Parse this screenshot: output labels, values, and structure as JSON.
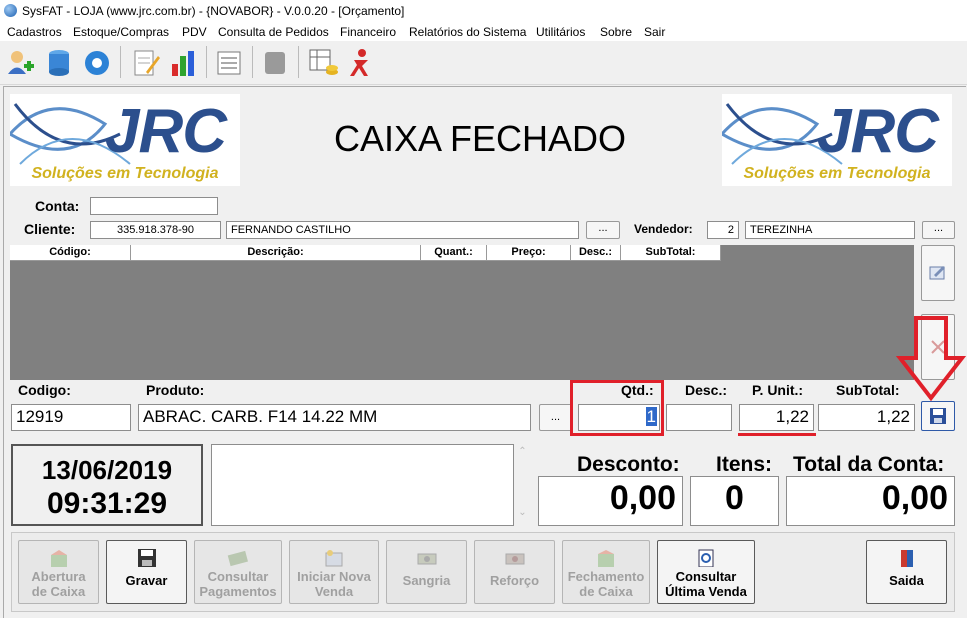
{
  "window": {
    "title": "SysFAT - LOJA (www.jrc.com.br) - {NOVABOR} - V.0.0.20 - [Orçamento]"
  },
  "menu": [
    "Cadastros",
    "Estoque/Compras",
    "PDV",
    "Consulta de Pedidos",
    "Financeiro",
    "Relatórios do Sistema",
    "Utilitários",
    "Sobre",
    "Sair"
  ],
  "logo": {
    "brand": "JRC",
    "tagline": "Soluções em Tecnologia"
  },
  "status": "CAIXA FECHADO",
  "form": {
    "conta_label": "Conta:",
    "conta_value": "",
    "cliente_label": "Cliente:",
    "cliente_doc": "335.918.378-90",
    "cliente_nome": "FERNANDO CASTILHO",
    "vendedor_label": "Vendedor:",
    "vendedor_code": "2",
    "vendedor_nome": "TEREZINHA",
    "ellipsis": "..."
  },
  "grid": {
    "columns": [
      "Código:",
      "Descrição:",
      "Quant.:",
      "Preço:",
      "Desc.:",
      "SubTotal:"
    ]
  },
  "item": {
    "codigo_label": "Codigo:",
    "produto_label": "Produto:",
    "qtd_label": "Qtd.:",
    "desc_label": "Desc.:",
    "punit_label": "P. Unit.:",
    "subtotal_label": "SubTotal:",
    "codigo": "12919",
    "produto": "ABRAC. CARB. F14 14.22 MM",
    "qtd": "1",
    "desc": "",
    "punit": "1,22",
    "subtotal": "1,22"
  },
  "clock": {
    "date": "13/06/2019",
    "time": "09:31:29"
  },
  "totals": {
    "desconto_label": "Desconto:",
    "itens_label": "Itens:",
    "total_label": "Total da Conta:",
    "desconto": "0,00",
    "itens": "0",
    "total": "0,00"
  },
  "buttons": {
    "abertura": [
      "Abertura",
      "de Caixa"
    ],
    "gravar": "Gravar",
    "consultar_pag": [
      "Consultar",
      "Pagamentos"
    ],
    "iniciar": [
      "Iniciar Nova",
      "Venda"
    ],
    "sangria": "Sangria",
    "reforco": "Reforço",
    "fechamento": [
      "Fechamento",
      "de Caixa"
    ],
    "ultima": [
      "Consultar",
      "Última Venda"
    ],
    "saida": "Saida"
  },
  "colors": {
    "highlight": "#e0202a",
    "brand_blue": "#2c4f8d",
    "brand_gold": "#d1b21f",
    "grid_bg": "#808080"
  }
}
